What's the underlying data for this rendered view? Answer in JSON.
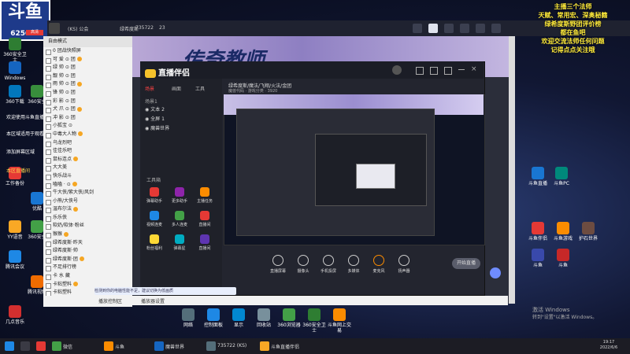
{
  "overlay_text": [
    "主播三个法师",
    "天赋、常用宏、深奥秘籍",
    "绿希度斯野团评价榜",
    "都在鱼吧",
    "欢迎交流法师任何问题",
    "记得点点关注哦"
  ],
  "logo": {
    "text": "斗鱼",
    "room_no": "625017"
  },
  "outer_window": {
    "title_tag": "(KS) 公会",
    "items": [
      "绿希度斯",
      "735722",
      "23"
    ]
  },
  "hq_badge": "高清",
  "desktop_icons_left": [
    {
      "label": "360安全卫士",
      "color": "#2e7d32"
    },
    {
      "label": "Windows",
      "color": "#1565c0"
    },
    {
      "label": "360下载",
      "color": "#0277bd"
    },
    {
      "label": "360安全",
      "color": "#388e3c"
    },
    {
      "label": "工作备份",
      "color": "#e53935"
    },
    {
      "label": "优酷",
      "color": "#1976d2"
    },
    {
      "label": "YY语音",
      "color": "#f9a825"
    },
    {
      "label": "360安全",
      "color": "#43a047"
    },
    {
      "label": "腾讯会议",
      "color": "#1e88e5"
    },
    {
      "label": "腾讯视频",
      "color": "#ef6c00"
    },
    {
      "label": "几点音乐",
      "color": "#d32f2f"
    }
  ],
  "left_notices": [
    "欢迎使用斗鱼直播助手",
    "本区域适用于观看网页和直播",
    "添加屏幕区域",
    "本区直播间"
  ],
  "chat": {
    "header": "自由模式",
    "rows": [
      "0 团战快照屏",
      "可 爱 ⊙ 团",
      "绿 帅 ⊙ 团",
      "靓 帅 ⊙ 团",
      "雨 帅 ⊙ 团",
      "锋 帅 ⊙ 团",
      "彩 影 ⊙ 团",
      "犬 爪 ⊙ 团",
      "冲 影 ⊙ 团",
      "小狐宝 ⊙",
      "中毒大人物",
      "乌龙烈吧",
      "佳佳乐吧",
      "鼠标连点",
      "大大美",
      "快乐战斗",
      "嗑嗑 · ⊙",
      "牛大侠/紫大侠/风剑",
      "小熊/大侠号",
      "温布尔法",
      "乐乐侠",
      "软奶/软体·粉丝",
      "猴猴",
      "绿希度斯·昨天",
      "绿希度斯·帅",
      "绿希度斯·团",
      "不足排行榜",
      "卡 水 藏",
      "卡粘塑料",
      "卡粘塑料",
      "智能模式"
    ]
  },
  "main_banner_title": "传奇教师",
  "zb": {
    "app_name": "直播伴侣",
    "tabs": [
      "场景",
      "画面",
      "工具"
    ],
    "scene_label": "场景1",
    "layers": [
      "文本 2",
      "全屏 1",
      "魔兽世界"
    ],
    "tools_header": "工具箱",
    "tools": [
      {
        "label": "弹幕助手",
        "color": "#e53935"
      },
      {
        "label": "更多助手",
        "color": "#8e24aa"
      },
      {
        "label": "主播任务",
        "color": "#fb8c00"
      },
      {
        "label": "视频连麦",
        "color": "#1e88e5"
      },
      {
        "label": "多人连麦",
        "color": "#43a047"
      },
      {
        "label": "直播间",
        "color": "#e53935"
      },
      {
        "label": "粉丝福利",
        "color": "#fdd835"
      },
      {
        "label": "弹幕星",
        "color": "#00acc1"
      },
      {
        "label": "直播间",
        "color": "#5e35b1"
      }
    ],
    "room_title": "绿希度斯/魔法/飞翔/火法/金团",
    "room_meta": [
      "魔兽代码",
      "游戏分类",
      "3920"
    ],
    "bottom_tools": [
      "直播屏幕",
      "摄像头",
      "手机投屏",
      "多媒体",
      "麦克风",
      "扬声器"
    ],
    "start_live": "开始直播",
    "status": "9个视频源正常运行中"
  },
  "notice": "检测到你的电脑性能不足，建议切换为低画质",
  "player_bar": [
    "播放控制区",
    "播放器设置"
  ],
  "desktop_icons_right": [
    {
      "label": "斗鱼直播",
      "color": "#1976d2"
    },
    {
      "label": "斗鱼PC",
      "color": "#00897b"
    },
    {
      "label": "斗鱼伴侣",
      "color": "#e53935"
    },
    {
      "label": "斗鱼游戏",
      "color": "#fb8c00"
    },
    {
      "label": "护石世界",
      "color": "#6d4c41"
    },
    {
      "label": "斗鱼",
      "color": "#3949ab"
    },
    {
      "label": "斗鱼",
      "color": "#c62828"
    }
  ],
  "desktop_icons_bottom": [
    "网络",
    "控制面板",
    "显示",
    "回收站",
    "360浏览器",
    "360安全卫士",
    "斗鱼网上交易"
  ],
  "activate": [
    "激活 Windows",
    "转到\"设置\"以激活 Windows。"
  ],
  "taskbar": {
    "apps": [
      {
        "label": "",
        "color": "#1e88e5"
      },
      {
        "label": "",
        "color": "#e53935"
      },
      {
        "label": "微信",
        "color": "#43a047"
      },
      {
        "label": "斗鱼",
        "color": "#fb8c00"
      },
      {
        "label": "魔兽世界",
        "color": "#1565c0"
      },
      {
        "label": "735722 (KS)",
        "color": "#546e7a"
      },
      {
        "label": "斗鱼直播伴侣",
        "color": "#f9a825"
      }
    ],
    "clock_time": "19:17",
    "clock_date": "2022/6/6"
  }
}
